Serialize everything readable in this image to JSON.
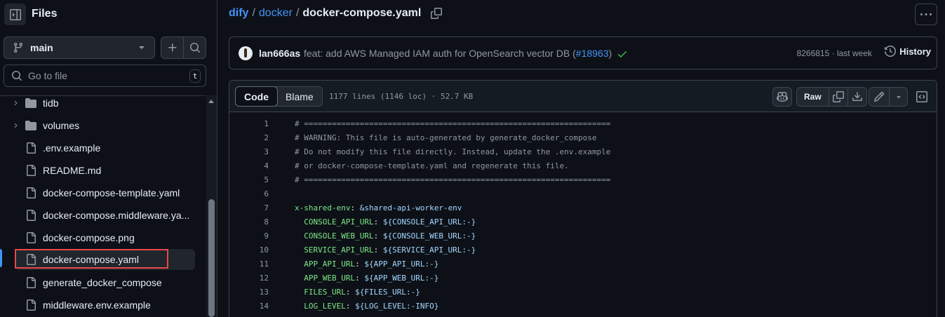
{
  "sidebar": {
    "title": "Files",
    "branch": "main",
    "search_placeholder": "Go to file",
    "search_shortcut": "t",
    "items": [
      {
        "type": "folder",
        "name": "tidb"
      },
      {
        "type": "folder",
        "name": "volumes"
      },
      {
        "type": "file",
        "name": ".env.example"
      },
      {
        "type": "file",
        "name": "README.md"
      },
      {
        "type": "file",
        "name": "docker-compose-template.yaml"
      },
      {
        "type": "file",
        "name": "docker-compose.middleware.ya..."
      },
      {
        "type": "file",
        "name": "docker-compose.png"
      },
      {
        "type": "file",
        "name": "docker-compose.yaml",
        "selected": true
      },
      {
        "type": "file",
        "name": "generate_docker_compose"
      },
      {
        "type": "file",
        "name": "middleware.env.example"
      }
    ]
  },
  "breadcrumb": {
    "repo": "dify",
    "folder": "docker",
    "separator": "/",
    "file": "docker-compose.yaml"
  },
  "commit": {
    "author": "lan666as",
    "message": "feat: add AWS Managed IAM auth for OpenSearch vector DB (",
    "pr": "#18963",
    "message_end": ")",
    "hash": "8266815",
    "dot": "·",
    "time": "last week",
    "history_label": "History"
  },
  "file_header": {
    "tab_code": "Code",
    "tab_blame": "Blame",
    "stats": "1177 lines (1146 loc) · 52.7 KB",
    "raw_label": "Raw"
  },
  "code_lines": [
    {
      "n": "1",
      "comment": "# =================================================================="
    },
    {
      "n": "2",
      "comment": "# WARNING: This file is auto-generated by generate_docker_compose"
    },
    {
      "n": "3",
      "comment": "# Do not modify this file directly. Instead, update the .env.example"
    },
    {
      "n": "4",
      "comment": "# or docker-compose-template.yaml and regenerate this file."
    },
    {
      "n": "5",
      "comment": "# =================================================================="
    },
    {
      "n": "6",
      "comment": ""
    },
    {
      "n": "7",
      "indent": "",
      "key": "x-shared-env",
      "value": "&shared-api-worker-env"
    },
    {
      "n": "8",
      "indent": "  ",
      "key": "CONSOLE_API_URL",
      "value": "${CONSOLE_API_URL:-}"
    },
    {
      "n": "9",
      "indent": "  ",
      "key": "CONSOLE_WEB_URL",
      "value": "${CONSOLE_WEB_URL:-}"
    },
    {
      "n": "10",
      "indent": "  ",
      "key": "SERVICE_API_URL",
      "value": "${SERVICE_API_URL:-}"
    },
    {
      "n": "11",
      "indent": "  ",
      "key": "APP_API_URL",
      "value": "${APP_API_URL:-}"
    },
    {
      "n": "12",
      "indent": "  ",
      "key": "APP_WEB_URL",
      "value": "${APP_WEB_URL:-}"
    },
    {
      "n": "13",
      "indent": "  ",
      "key": "FILES_URL",
      "value": "${FILES_URL:-}"
    },
    {
      "n": "14",
      "indent": "  ",
      "key": "LOG_LEVEL",
      "value": "${LOG_LEVEL:-INFO}"
    }
  ],
  "colors": {
    "background": "#0d1117",
    "accent_link": "#4493f8",
    "yaml_key": "#7ee787",
    "yaml_value": "#a5d6ff",
    "success_check": "#3fb950",
    "selection_highlight": "#e5484d"
  }
}
